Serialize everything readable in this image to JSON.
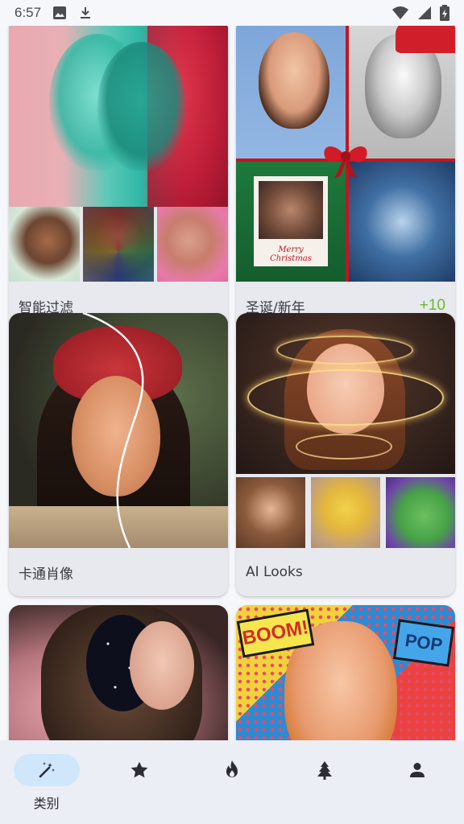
{
  "status_bar": {
    "time": "6:57",
    "left_icons": [
      "image-icon",
      "download-icon"
    ],
    "right_icons": [
      "wifi-icon",
      "signal-icon",
      "battery-icon"
    ]
  },
  "cards": [
    {
      "title": "智能过滤",
      "count": ""
    },
    {
      "title": "圣诞/新年",
      "count": "+10"
    },
    {
      "title": "卡通肖像",
      "count": ""
    },
    {
      "title": "AI Looks",
      "count": ""
    },
    {
      "title": "",
      "count": ""
    },
    {
      "title": "",
      "count": "",
      "comic_words": [
        "BOOM!",
        "POP"
      ]
    }
  ],
  "card_art": {
    "christmas_photo_caption": "Merry Christmas"
  },
  "bottom_nav": {
    "items": [
      {
        "icon": "magic-wand-icon",
        "label": "类别",
        "active": true
      },
      {
        "icon": "star-icon",
        "label": "",
        "active": false
      },
      {
        "icon": "flame-icon",
        "label": "",
        "active": false
      },
      {
        "icon": "tree-icon",
        "label": "",
        "active": false
      },
      {
        "icon": "person-icon",
        "label": "",
        "active": false
      }
    ]
  },
  "colors": {
    "background": "#f6f7fb",
    "card_footer": "#e8e9ef",
    "nav_background": "#eceef5",
    "active_pill": "#cfe6fb",
    "count_green": "#6ab82e"
  }
}
